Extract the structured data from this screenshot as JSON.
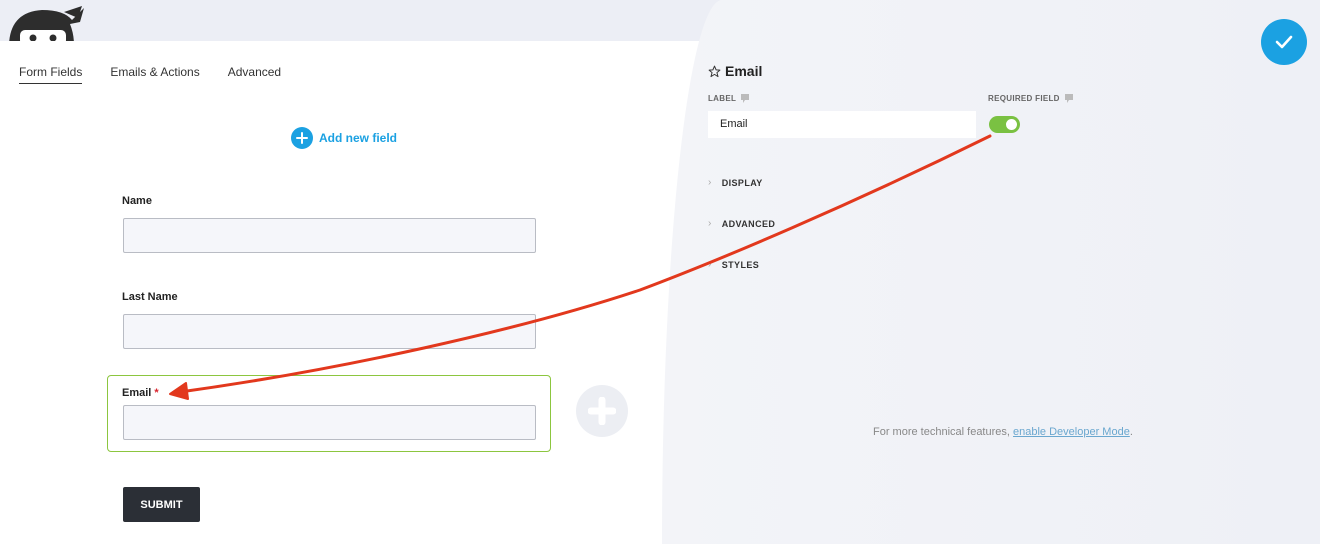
{
  "tabs": [
    {
      "label": "Form Fields",
      "active": true
    },
    {
      "label": "Emails & Actions",
      "active": false
    },
    {
      "label": "Advanced",
      "active": false
    }
  ],
  "add_field_label": "Add new field",
  "fields": {
    "name_label": "Name",
    "last_name_label": "Last Name",
    "email_label": "Email",
    "required_marker": "*"
  },
  "submit_label": "SUBMIT",
  "drawer": {
    "title": "Email",
    "label_caption": "LABEL",
    "label_value": "Email",
    "required_caption": "REQUIRED FIELD",
    "required_on": true,
    "sections": [
      "DISPLAY",
      "ADVANCED",
      "STYLES"
    ],
    "footer_text": "For more technical features, ",
    "footer_link": "enable Developer Mode",
    "footer_end": "."
  },
  "colors": {
    "accent": "#1ba1e2",
    "toggle_on": "#7ac142",
    "highlight_border": "#8cc63f",
    "arrow": "#e2381d"
  }
}
